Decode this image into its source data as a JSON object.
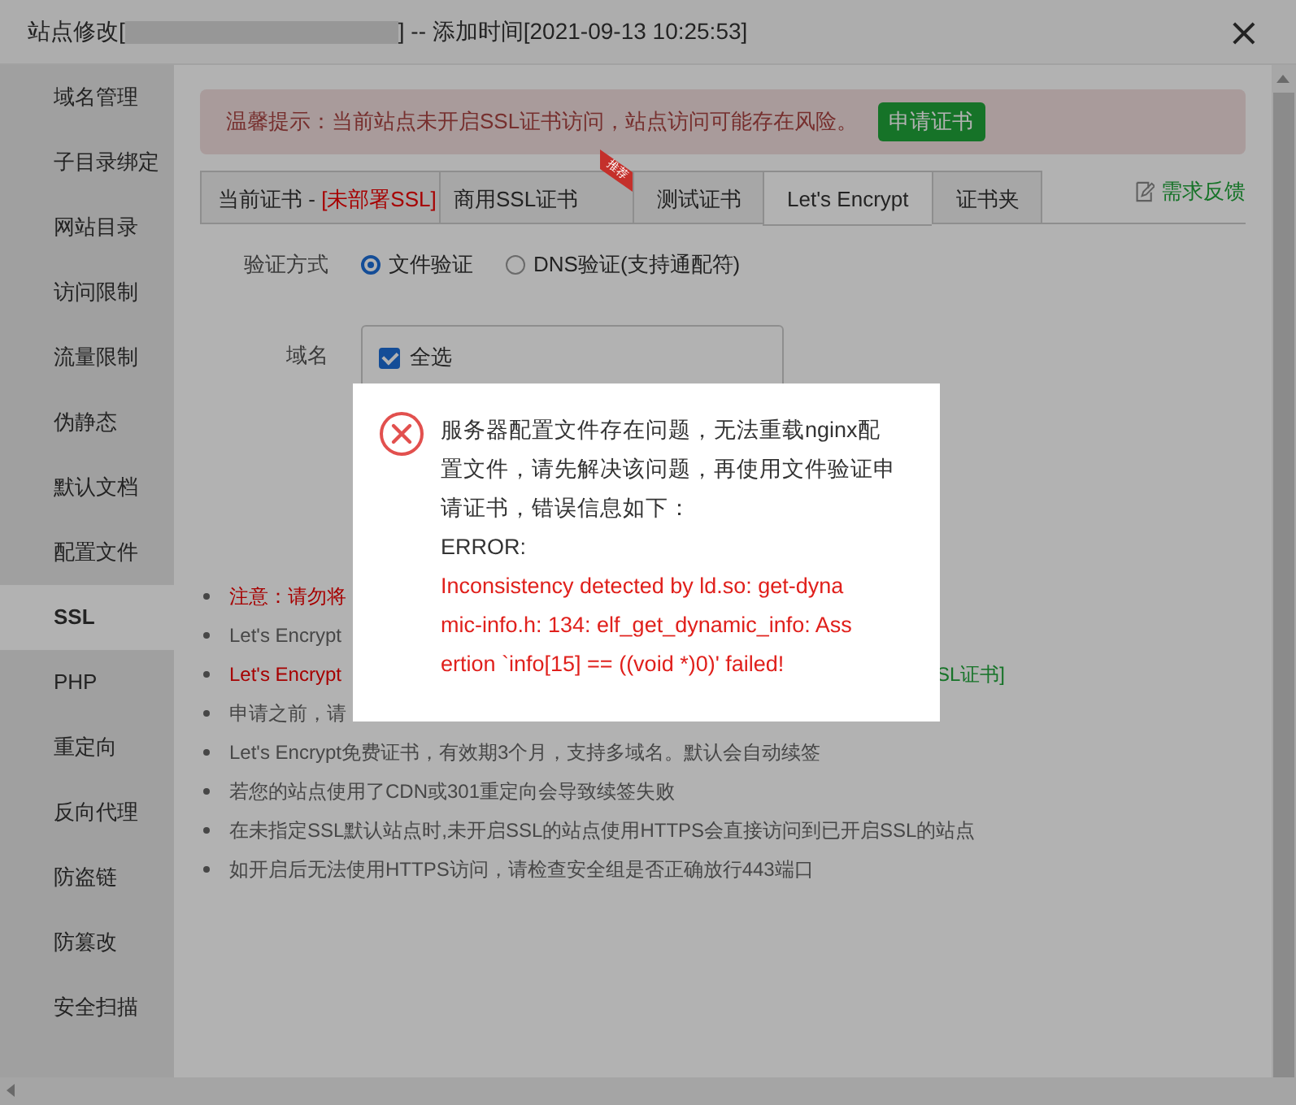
{
  "window": {
    "title_prefix": "站点修改[",
    "title_suffix": "] -- 添加时间[2021-09-13 10:25:53]",
    "close": "×"
  },
  "sidebar": {
    "items": [
      {
        "label": "域名管理",
        "selected": false
      },
      {
        "label": "子目录绑定",
        "selected": false
      },
      {
        "label": "网站目录",
        "selected": false
      },
      {
        "label": "访问限制",
        "selected": false
      },
      {
        "label": "流量限制",
        "selected": false
      },
      {
        "label": "伪静态",
        "selected": false
      },
      {
        "label": "默认文档",
        "selected": false
      },
      {
        "label": "配置文件",
        "selected": false
      },
      {
        "label": "SSL",
        "selected": true
      },
      {
        "label": "PHP",
        "selected": false
      },
      {
        "label": "重定向",
        "selected": false
      },
      {
        "label": "反向代理",
        "selected": false
      },
      {
        "label": "防盗链",
        "selected": false
      },
      {
        "label": "防篡改",
        "selected": false
      },
      {
        "label": "安全扫描",
        "selected": false
      }
    ]
  },
  "alert": {
    "text": "温馨提示：当前站点未开启SSL证书访问，站点访问可能存在风险。",
    "button": "申请证书"
  },
  "tabs": [
    {
      "label": "当前证书 - ",
      "status": "[未部署SSL]",
      "selected": false
    },
    {
      "label": "商用SSL证书",
      "badge": "推荐",
      "selected": false
    },
    {
      "label": "测试证书",
      "selected": false
    },
    {
      "label": "Let's Encrypt",
      "selected": true
    },
    {
      "label": "证书夹",
      "selected": false
    }
  ],
  "feedback_link": "需求反馈",
  "form": {
    "method_label": "验证方式",
    "methods": [
      {
        "label": "文件验证",
        "selected": true
      },
      {
        "label": "DNS验证(支持通配符)",
        "selected": false
      }
    ],
    "domain_label": "域名",
    "select_all": {
      "label": "全选",
      "checked": true
    }
  },
  "notes": [
    {
      "kind": "warning",
      "text": "注意：请勿将"
    },
    {
      "kind": "plain",
      "text": "Let's Encrypt "
    },
    {
      "kind": "warning",
      "text": "Let's Encrypt",
      "link": "SL证书]"
    },
    {
      "kind": "plain",
      "text": "申请之前，请"
    },
    {
      "kind": "plain",
      "text": "Let's Encrypt免费证书，有效期3个月，支持多域名。默认会自动续签"
    },
    {
      "kind": "plain",
      "text": "若您的站点使用了CDN或301重定向会导致续签失败"
    },
    {
      "kind": "plain",
      "text": "在未指定SSL默认站点时,未开启SSL的站点使用HTTPS会直接访问到已开启SSL的站点"
    },
    {
      "kind": "plain",
      "text": "如开启后无法使用HTTPS访问，请检查安全组是否正确放行443端口"
    }
  ],
  "dialog": {
    "message_lines": [
      "服务器配置文件存在问题，无法重载nginx配",
      "置文件，请先解决该问题，再使用文件验证申",
      "请证书，错误信息如下：",
      "ERROR:"
    ],
    "error_lines": [
      "Inconsistency detected by ld.so: get-dyna",
      "mic-info.h: 134: elf_get_dynamic_info: Ass",
      "ertion `info[15] == ((void *)0)' failed!"
    ]
  }
}
